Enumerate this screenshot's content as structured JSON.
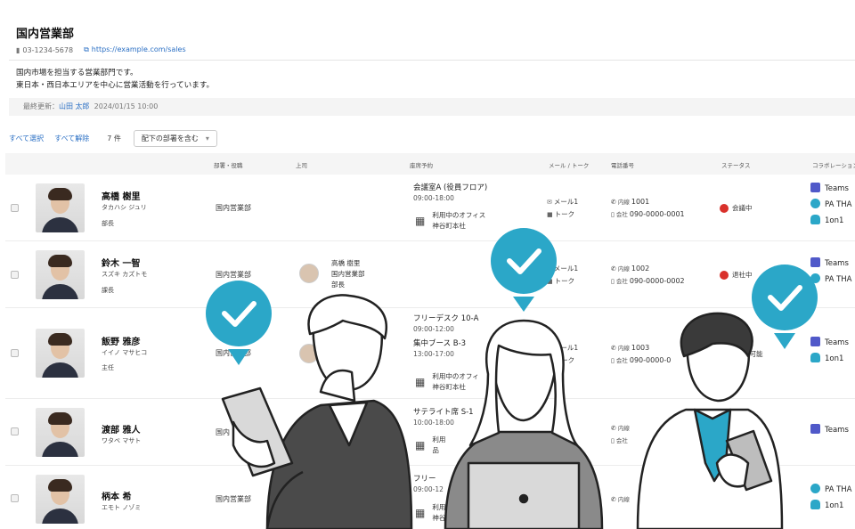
{
  "header": {
    "title": "国内営業部",
    "phone": "03-1234-5678",
    "url": "https://example.com/sales",
    "description_line1": "国内市場を担当する営業部門です。",
    "description_line2": "東日本・西日本エリアを中心に営業活動を行っています。",
    "updated_label": "最終更新：",
    "updated_user": "山田 太郎",
    "updated_time": "2024/01/15 10:00"
  },
  "toolbar": {
    "select_all": "すべて選択",
    "deselect_all": "すべて解除",
    "count": "7 件",
    "filter_label": "配下の部署を含む",
    "filter_caret": "▾"
  },
  "columns": {
    "dept": "部署・役職",
    "boss": "上司",
    "seat": "座席予約",
    "mail": "メール / トーク",
    "phone": "電話番号",
    "status": "ステータス",
    "collab": "コラボレーション"
  },
  "labels": {
    "mail": "メール1",
    "talk": "トーク",
    "ext": "内線",
    "company": "会社",
    "office_line1": "利用中のオフィス",
    "office_line2": "神谷町本社",
    "teams": "Teams",
    "pa": "PA THA",
    "oneon": "1on1"
  },
  "rows": [
    {
      "name": "高橋 樹里",
      "kana": "タカハシ ジュリ",
      "role": "部長",
      "dept": "国内営業部",
      "seat1": "会議室A (役員フロア)",
      "time1": "09:00-18:00",
      "office2": "神谷町本社",
      "ext": "1001",
      "mobile": "090-0000-0001",
      "status": "会議中"
    },
    {
      "name": "鈴木 一智",
      "kana": "スズキ カズトモ",
      "role": "課長",
      "dept": "国内営業部",
      "boss_name": "高橋 樹里",
      "boss_dept": "国内営業部",
      "boss_role": "部長",
      "ext": "1002",
      "mobile": "090-0000-0002",
      "status": "退社中"
    },
    {
      "name": "飯野 雅彦",
      "kana": "イイノ マサヒコ",
      "role": "主任",
      "dept": "国内営業部",
      "seat1": "フリーデスク 10-A",
      "time1": "09:00-12:00",
      "seat2": "集中ブース B-3",
      "time2": "13:00-17:00",
      "office1": "利用中のオフィ",
      "office2": "神谷町本社",
      "ext": "1003",
      "mobile": "090-0000-0",
      "status": "会可能"
    },
    {
      "name": "渡部 雅人",
      "kana": "ワタベ マサト",
      "dept": "国内",
      "seat1": "サテライト席 S-1",
      "time1": "10:00-18:00",
      "office1": "利用",
      "office2": "品"
    },
    {
      "name": "柄本 希",
      "kana": "エモト ノゾミ",
      "dept": "国内営業部",
      "seat1": "フリー",
      "time1": "09:00-12",
      "office1": "利用中のオフィス",
      "office2": "神谷町本社"
    }
  ]
}
